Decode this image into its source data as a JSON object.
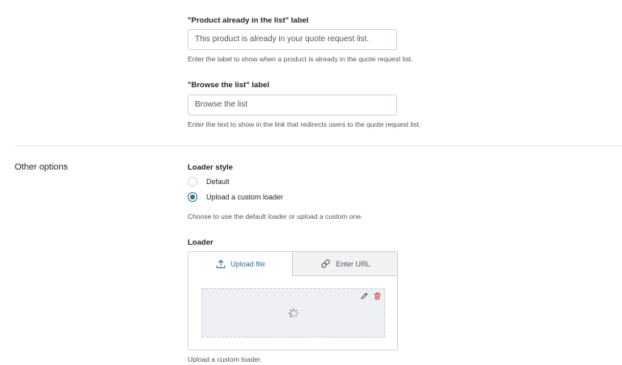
{
  "already_in_list": {
    "label": "\"Product already in the list\" label",
    "value": "This product is already in your quote request list.",
    "help": "Enter the label to show when a product is already in the quote request list."
  },
  "browse_list": {
    "label": "\"Browse the list\" label",
    "value": "Browse the list",
    "help": "Enter the text to show in the link that redirects users to the quote request list."
  },
  "other_options": {
    "title": "Other options",
    "loader_style": {
      "label": "Loader style",
      "options": [
        {
          "label": "Default",
          "checked": false
        },
        {
          "label": "Upload a custom loader",
          "checked": true
        }
      ],
      "help": "Choose to use the default loader or upload a custom one."
    },
    "loader": {
      "label": "Loader",
      "tabs": [
        {
          "label": "Upload file",
          "icon": "upload-icon",
          "active": true
        },
        {
          "label": "Enter URL",
          "icon": "link-icon",
          "active": false
        }
      ],
      "preview_icons": [
        "pencil-icon",
        "trash-icon",
        "spinner-icon"
      ],
      "help": "Upload a custom loader."
    }
  },
  "colors": {
    "accent": "#2f6f8f",
    "delete": "#d63638",
    "border": "#c7d3d9"
  }
}
